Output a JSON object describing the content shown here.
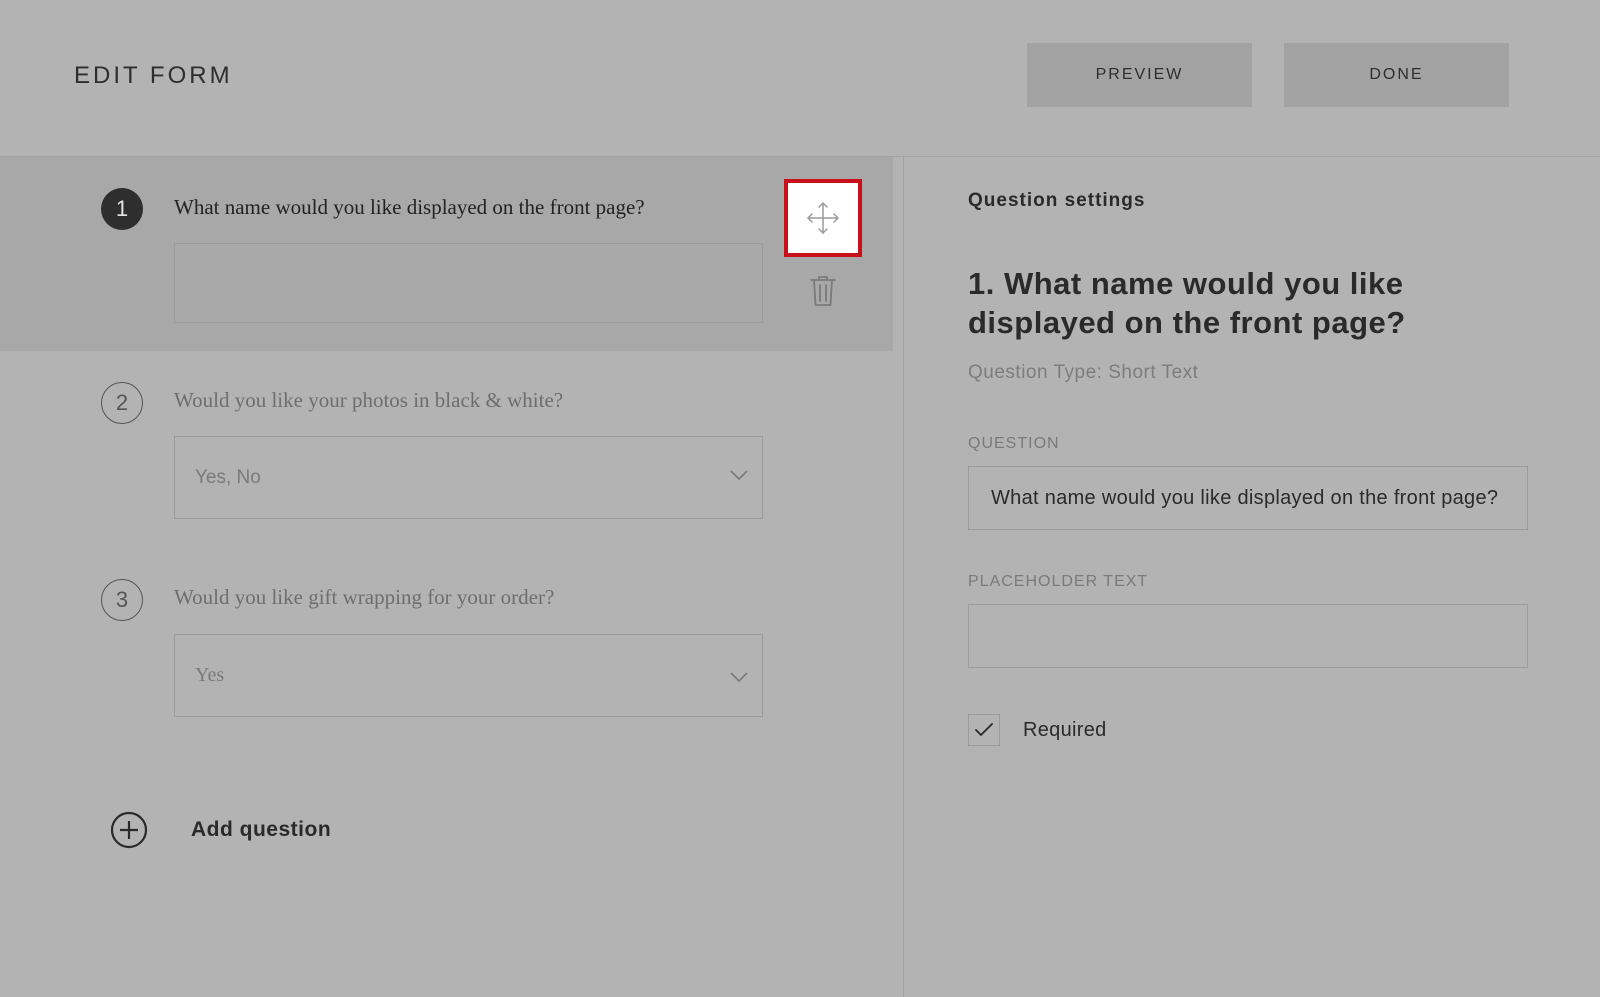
{
  "header": {
    "title": "EDIT FORM",
    "preview_label": "PREVIEW",
    "done_label": "DONE"
  },
  "questions": [
    {
      "number": "1",
      "text": "What name would you like displayed on the front page?",
      "type": "text",
      "value": ""
    },
    {
      "number": "2",
      "text": "Would you like your photos in black & white?",
      "type": "select",
      "value": "Yes, No"
    },
    {
      "number": "3",
      "text": "Would you like gift wrapping for your order?",
      "type": "select",
      "value": "Yes"
    }
  ],
  "add_question_label": "Add question",
  "settings": {
    "title": "Question settings",
    "heading": "1. What name would you like displayed on the front page?",
    "question_type": "Question Type: Short Text",
    "question_label": "QUESTION",
    "question_value": "What name would you like displayed on the front page?",
    "placeholder_label": "PLACEHOLDER TEXT",
    "placeholder_value": "",
    "required_label": "Required",
    "required_checked": true
  },
  "colors": {
    "background": "#b3b3b3",
    "highlight": "#c8101a",
    "active_badge": "#2e2e2e"
  },
  "icons": {
    "move": "move-arrows-icon",
    "delete": "trash-icon",
    "add": "plus-circle-icon",
    "dropdown": "chevron-down-icon",
    "check": "checkmark-icon"
  }
}
